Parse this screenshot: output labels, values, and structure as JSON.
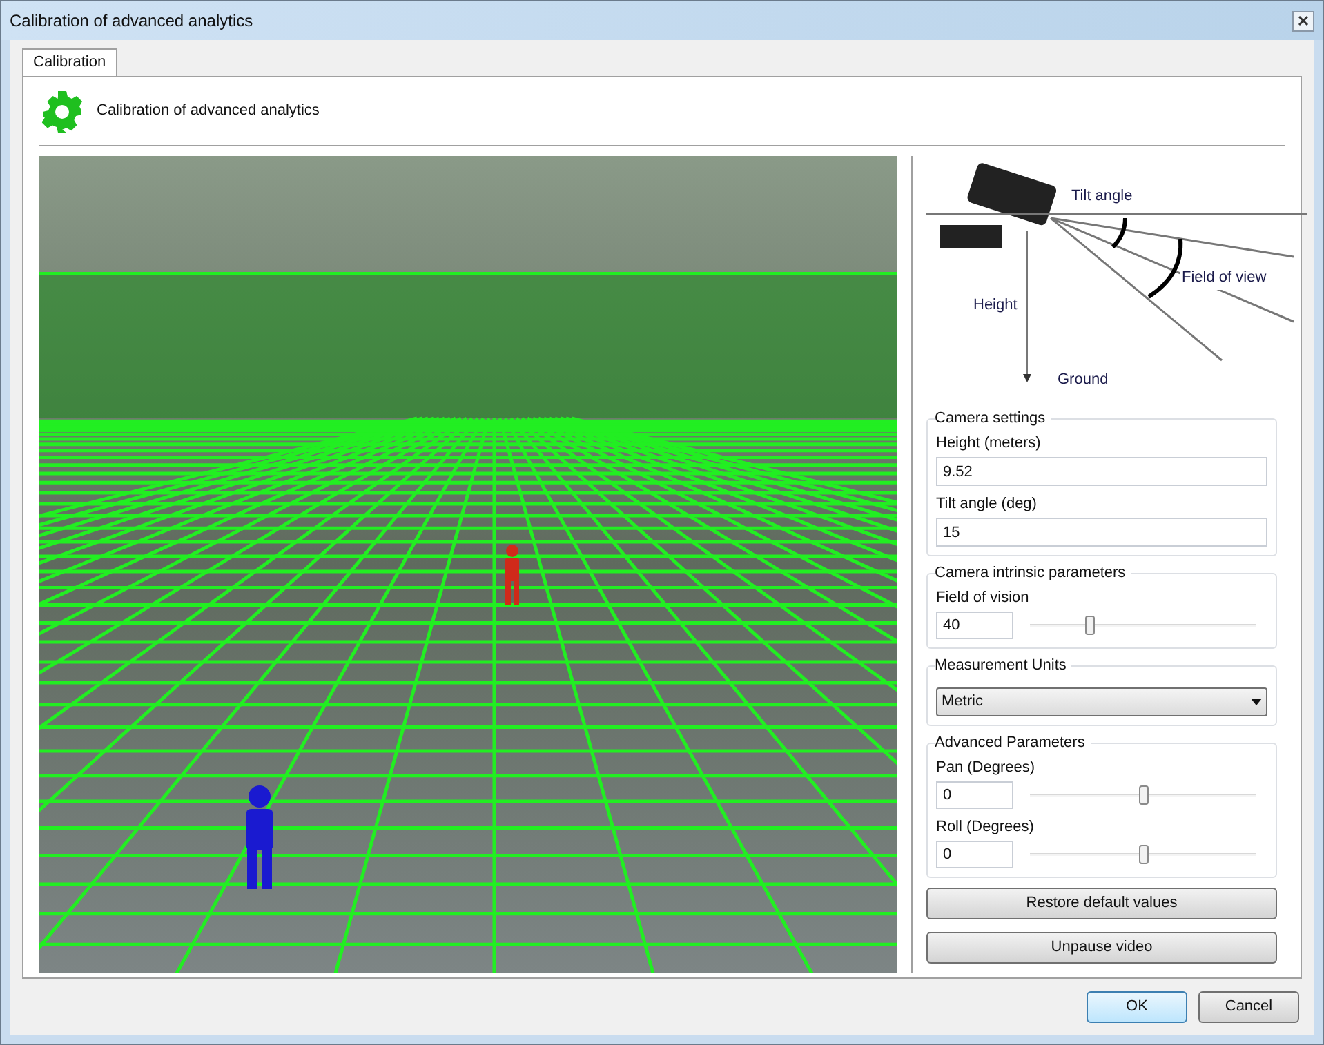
{
  "window": {
    "title": "Calibration of advanced analytics"
  },
  "tabs": [
    {
      "label": "Calibration",
      "selected": true
    }
  ],
  "header": {
    "title": "Calibration of advanced analytics"
  },
  "diagram": {
    "labels": {
      "tilt": "Tilt angle",
      "fov": "Field of view",
      "height": "Height",
      "ground": "Ground"
    }
  },
  "camera_settings": {
    "title": "Camera settings",
    "fields": [
      {
        "label": "Height (meters)",
        "value": "9.52"
      },
      {
        "label": "Tilt angle (deg)",
        "value": "15"
      }
    ]
  },
  "intrinsic": {
    "title": "Camera intrinsic parameters",
    "rows": [
      {
        "label": "Field of vision",
        "value": "40",
        "level": 0.26
      }
    ]
  },
  "units": {
    "title": "Measurement Units",
    "value": "Metric"
  },
  "advanced": {
    "title": "Advanced Parameters",
    "rows": [
      {
        "label": "Pan (Degrees)",
        "value": "0",
        "level": 0.5
      },
      {
        "label": "Roll (Degrees)",
        "value": "0",
        "level": 0.5
      }
    ]
  },
  "actions": [
    "Restore default values",
    "Unpause video"
  ],
  "buttons": [
    {
      "label": "OK",
      "default": true
    },
    {
      "label": "Cancel",
      "default": false
    }
  ]
}
